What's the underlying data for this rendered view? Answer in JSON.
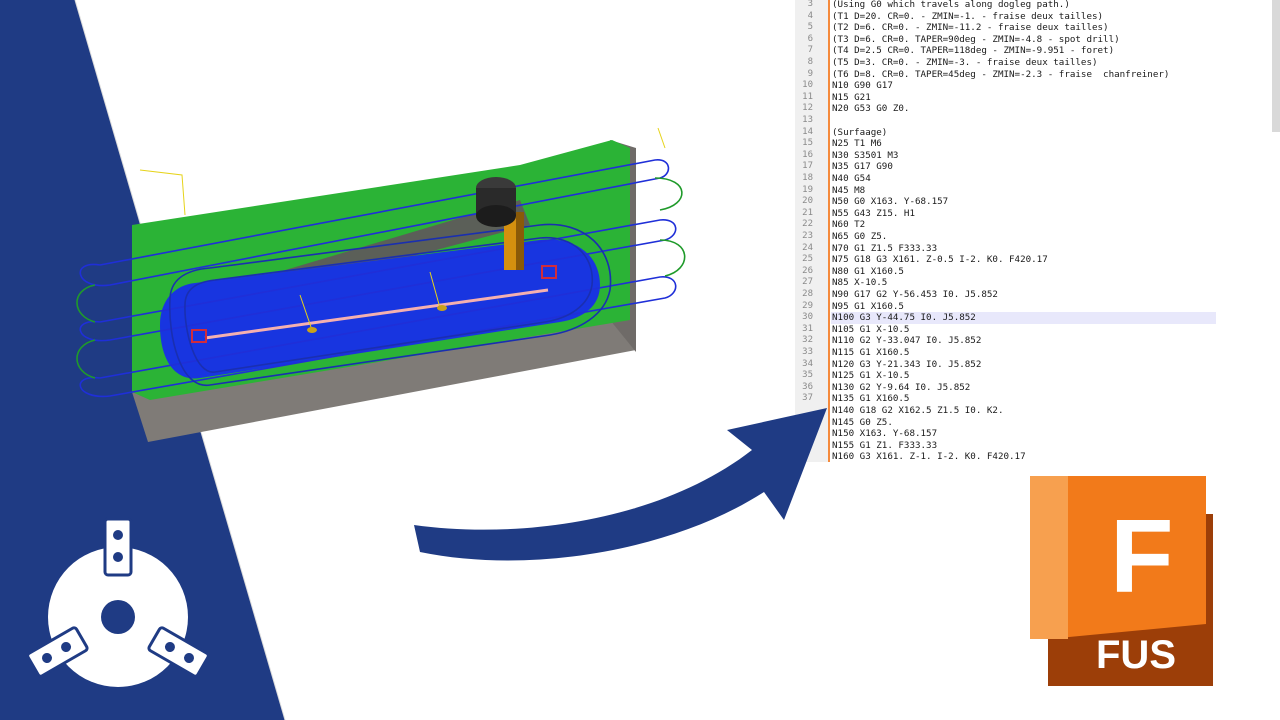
{
  "editor": {
    "lines": [
      {
        "n": "3",
        "text": "(Using G0 which travels along dogleg path.)"
      },
      {
        "n": "4",
        "text": "(T1 D=20. CR=0. - ZMIN=-1. - fraise deux tailles)"
      },
      {
        "n": "5",
        "text": "(T2 D=6. CR=0. - ZMIN=-11.2 - fraise deux tailles)"
      },
      {
        "n": "6",
        "text": "(T3 D=6. CR=0. TAPER=90deg - ZMIN=-4.8 - spot drill)"
      },
      {
        "n": "7",
        "text": "(T4 D=2.5 CR=0. TAPER=118deg - ZMIN=-9.951 - foret)"
      },
      {
        "n": "8",
        "text": "(T5 D=3. CR=0. - ZMIN=-3. - fraise deux tailles)"
      },
      {
        "n": "9",
        "text": "(T6 D=8. CR=0. TAPER=45deg - ZMIN=-2.3 - fraise  chanfreiner)"
      },
      {
        "n": "10",
        "text": "N10 G90 G17"
      },
      {
        "n": "11",
        "text": "N15 G21"
      },
      {
        "n": "12",
        "text": "N20 G53 G0 Z0."
      },
      {
        "n": "13",
        "text": ""
      },
      {
        "n": "14",
        "text": "(Surfaage)"
      },
      {
        "n": "15",
        "text": "N25 T1 M6"
      },
      {
        "n": "16",
        "text": "N30 S3501 M3"
      },
      {
        "n": "17",
        "text": "N35 G17 G90"
      },
      {
        "n": "18",
        "text": "N40 G54"
      },
      {
        "n": "19",
        "text": "N45 M8"
      },
      {
        "n": "20",
        "text": "N50 G0 X163. Y-68.157"
      },
      {
        "n": "21",
        "text": "N55 G43 Z15. H1"
      },
      {
        "n": "22",
        "text": "N60 T2"
      },
      {
        "n": "23",
        "text": "N65 G0 Z5."
      },
      {
        "n": "24",
        "text": "N70 G1 Z1.5 F333.33"
      },
      {
        "n": "25",
        "text": "N75 G18 G3 X161. Z-0.5 I-2. K0. F420.17"
      },
      {
        "n": "26",
        "text": "N80 G1 X160.5"
      },
      {
        "n": "27",
        "text": "N85 X-10.5"
      },
      {
        "n": "28",
        "text": "N90 G17 G2 Y-56.453 I0. J5.852"
      },
      {
        "n": "29",
        "text": "N95 G1 X160.5"
      },
      {
        "n": "30",
        "text": "N100 G3 Y-44.75 I0. J5.852"
      },
      {
        "n": "31",
        "text": "N105 G1 X-10.5"
      },
      {
        "n": "32",
        "text": "N110 G2 Y-33.047 I0. J5.852"
      },
      {
        "n": "33",
        "text": "N115 G1 X160.5"
      },
      {
        "n": "34",
        "text": "N120 G3 Y-21.343 I0. J5.852"
      },
      {
        "n": "35",
        "text": "N125 G1 X-10.5"
      },
      {
        "n": "36",
        "text": "N130 G2 Y-9.64 I0. J5.852"
      },
      {
        "n": "37",
        "text": "N135 G1 X160.5"
      },
      {
        "n": "",
        "text": "N140 G18 G2 X162.5 Z1.5 I0. K2."
      },
      {
        "n": "",
        "text": "N145 G0 Z5."
      },
      {
        "n": "",
        "text": "N150 X163. Y-68.157"
      },
      {
        "n": "",
        "text": "N155 G1 Z1. F333.33"
      },
      {
        "n": "",
        "text": "N160 G3 X161. Z-1. I-2. K0. F420.17"
      }
    ],
    "highlighted_line": "30"
  },
  "fusion_logo": {
    "letter": "F",
    "caption": "FUS"
  },
  "colors": {
    "navy": "#1f3b84",
    "stock_green": "#2bb336",
    "stock_grey": "#807c78",
    "toolpath_blue": "#1f2fd8",
    "fusion_orange": "#f27a1a",
    "fusion_dark": "#9c3e08",
    "highlight": "#e8e8fb"
  },
  "icons": {
    "chuck_logo": "lathe-chuck-icon",
    "arrow": "curved-arrow-icon"
  }
}
